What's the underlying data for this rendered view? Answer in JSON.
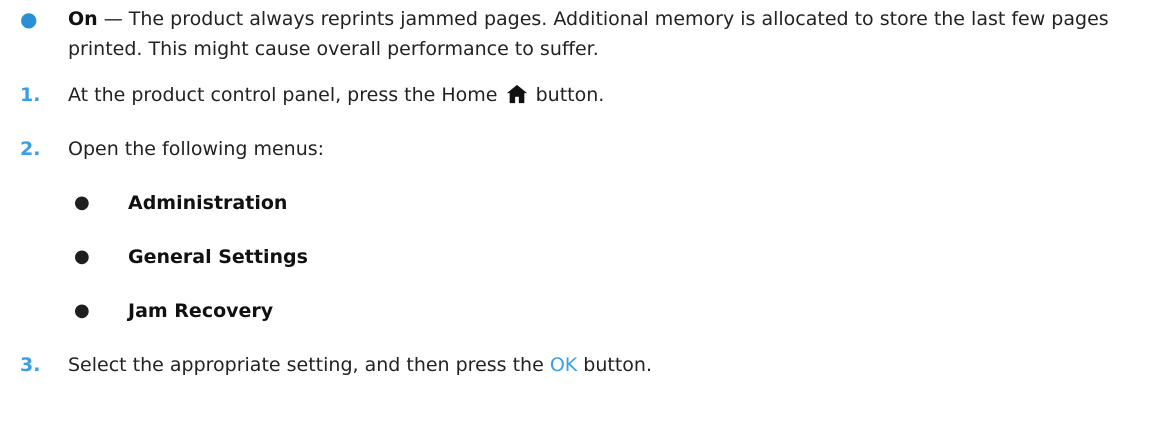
{
  "intro_bullet": {
    "term": "On",
    "dash": " — ",
    "text": "The product always reprints jammed pages. Additional memory is allocated to store the last few pages printed. This might cause overall performance to suffer."
  },
  "steps": [
    {
      "number": "1.",
      "before": "At the product control panel, press the Home",
      "icon": "home-icon",
      "after": "button."
    },
    {
      "number": "2.",
      "text": "Open the following menus:",
      "menus": [
        "Administration",
        "General Settings",
        "Jam Recovery"
      ]
    },
    {
      "number": "3.",
      "before": "Select the appropriate setting, and then press the",
      "highlight": "OK",
      "after": " button."
    }
  ],
  "colors": {
    "accent": "#3aa0e6",
    "text": "#222222"
  }
}
